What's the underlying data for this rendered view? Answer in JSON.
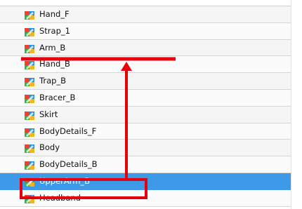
{
  "layers": [
    {
      "label": "Hand_F",
      "selected": false
    },
    {
      "label": "Strap_1",
      "selected": false
    },
    {
      "label": "Arm_B",
      "selected": false
    },
    {
      "label": "Hand_B",
      "selected": false
    },
    {
      "label": "Trap_B",
      "selected": false
    },
    {
      "label": "Bracer_B",
      "selected": false
    },
    {
      "label": "Skirt",
      "selected": false
    },
    {
      "label": "BodyDetails_F",
      "selected": false
    },
    {
      "label": "Body",
      "selected": false
    },
    {
      "label": "BodyDetails_B",
      "selected": false
    },
    {
      "label": "UpperArm_B",
      "selected": true
    },
    {
      "label": "Headband",
      "selected": false
    }
  ],
  "icon": "drawing-layer-icon",
  "colors": {
    "selection": "#3c9ae8",
    "annotation": "#e8000a",
    "row": "#f5f5f5"
  }
}
